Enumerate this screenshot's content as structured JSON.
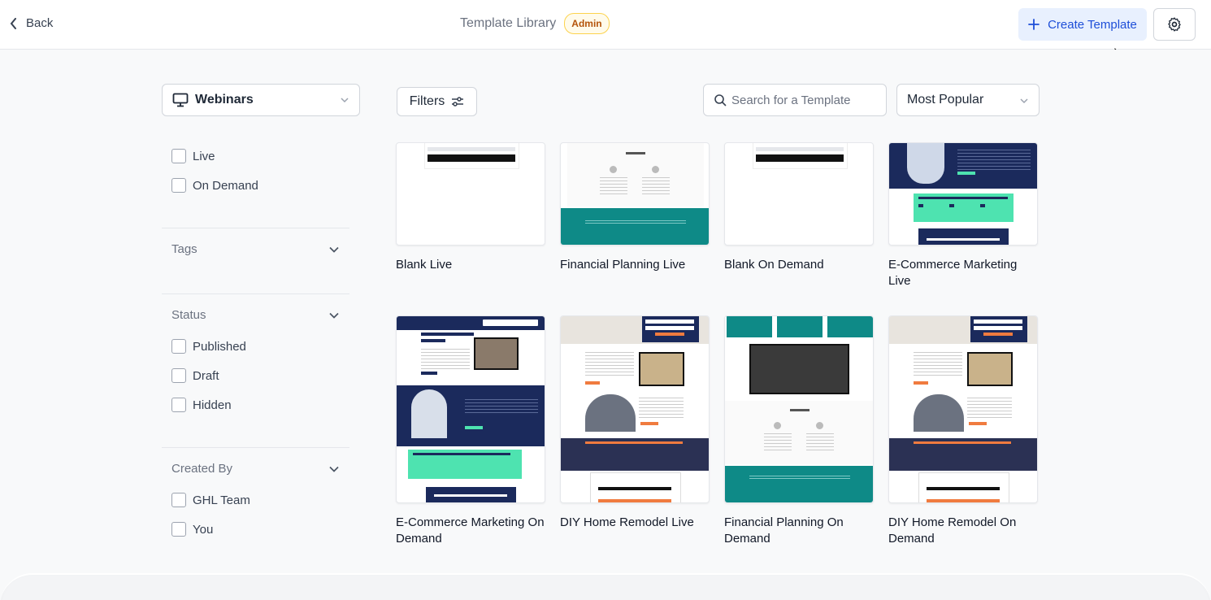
{
  "header": {
    "back_label": "Back",
    "title": "Template Library",
    "badge": "Admin",
    "create_label": "Create Template"
  },
  "sidebar": {
    "category": "Webinars",
    "types": [
      {
        "label": "Live",
        "checked": false
      },
      {
        "label": "On Demand",
        "checked": false
      }
    ],
    "tags_label": "Tags",
    "status_label": "Status",
    "status_options": [
      {
        "label": "Published",
        "checked": false
      },
      {
        "label": "Draft",
        "checked": false
      },
      {
        "label": "Hidden",
        "checked": false
      }
    ],
    "created_by_label": "Created By",
    "created_by_options": [
      {
        "label": "GHL Team",
        "checked": false
      },
      {
        "label": "You",
        "checked": false
      }
    ]
  },
  "toolbar": {
    "filters_label": "Filters",
    "search_placeholder": "Search for a Template",
    "sort_value": "Most Popular"
  },
  "templates": [
    {
      "name": "Blank Live",
      "style": "blank"
    },
    {
      "name": "Financial Planning Live",
      "style": "financial"
    },
    {
      "name": "Blank On Demand",
      "style": "blank"
    },
    {
      "name": "E-Commerce Marketing Live",
      "style": "ecommerce"
    },
    {
      "name": "E-Commerce Marketing On Demand",
      "style": "ecommerce-full"
    },
    {
      "name": "DIY Home Remodel Live",
      "style": "diy"
    },
    {
      "name": "Financial Planning On Demand",
      "style": "financial-full"
    },
    {
      "name": "DIY Home Remodel On Demand",
      "style": "diy"
    }
  ],
  "colors": {
    "accent": "#1d4ed8",
    "accent_bg": "#e8f0fe",
    "badge_text": "#b45309",
    "teal": "#0e8a87",
    "navy": "#1b2a5c",
    "mint": "#4ee3b0",
    "orange": "#f07b3f"
  }
}
